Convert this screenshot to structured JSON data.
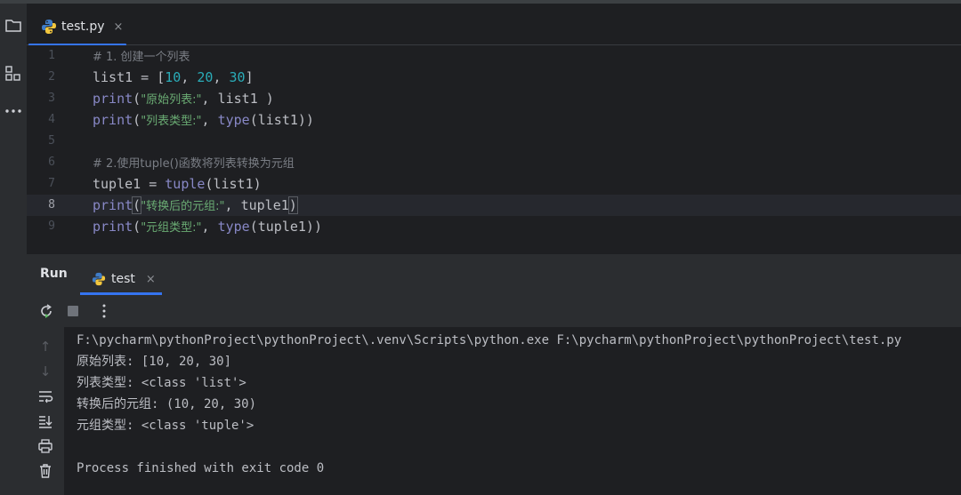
{
  "editor_tab": {
    "filename": "test.py",
    "close": "×"
  },
  "code_lines": [
    {
      "n": "1",
      "parts": [
        {
          "t": "# 1. 创建一个列表",
          "c": "cm"
        }
      ]
    },
    {
      "n": "2",
      "parts": [
        {
          "t": "list1 = ["
        },
        {
          "t": "10",
          "c": "num"
        },
        {
          "t": ", "
        },
        {
          "t": "20",
          "c": "num"
        },
        {
          "t": ", "
        },
        {
          "t": "30",
          "c": "num"
        },
        {
          "t": "]"
        }
      ]
    },
    {
      "n": "3",
      "parts": [
        {
          "t": "print",
          "c": "kw"
        },
        {
          "t": "("
        },
        {
          "t": "\"原始列表:\"",
          "c": "str"
        },
        {
          "t": ", list1 )"
        }
      ]
    },
    {
      "n": "4",
      "parts": [
        {
          "t": "print",
          "c": "kw"
        },
        {
          "t": "("
        },
        {
          "t": "\"列表类型:\"",
          "c": "str"
        },
        {
          "t": ", "
        },
        {
          "t": "type",
          "c": "kw"
        },
        {
          "t": "(list1))"
        }
      ]
    },
    {
      "n": "5",
      "parts": []
    },
    {
      "n": "6",
      "parts": [
        {
          "t": "# 2.使用tuple()函数将列表转换为元组",
          "c": "cm"
        }
      ]
    },
    {
      "n": "7",
      "parts": [
        {
          "t": "tuple1 = "
        },
        {
          "t": "tuple",
          "c": "kw"
        },
        {
          "t": "(list1)"
        }
      ]
    },
    {
      "n": "8",
      "current": true,
      "parts": [
        {
          "t": "print",
          "c": "kw"
        },
        {
          "t": "(",
          "c": "bm"
        },
        {
          "t": "\"转换后的元组:\"",
          "c": "str"
        },
        {
          "t": ", tuple1"
        },
        {
          "t": ")",
          "c": "bm"
        }
      ]
    },
    {
      "n": "9",
      "parts": [
        {
          "t": "print",
          "c": "kw"
        },
        {
          "t": "("
        },
        {
          "t": "\"元组类型:\"",
          "c": "str"
        },
        {
          "t": ", "
        },
        {
          "t": "type",
          "c": "kw"
        },
        {
          "t": "(tuple1))"
        }
      ]
    }
  ],
  "run_panel": {
    "title": "Run",
    "tab_label": "test",
    "tab_close": "×",
    "console_lines": [
      "F:\\pycharm\\pythonProject\\pythonProject\\.venv\\Scripts\\python.exe F:\\pycharm\\pythonProject\\pythonProject\\test.py",
      "原始列表: [10, 20, 30]",
      "列表类型: <class 'list'>",
      "转换后的元组: (10, 20, 30)",
      "元组类型: <class 'tuple'>",
      "",
      "Process finished with exit code 0"
    ]
  },
  "colors": {
    "accent": "#3574f0",
    "background": "#1e1f22",
    "panel": "#2b2d30",
    "string": "#6aab73",
    "keyword": "#8888c6",
    "number": "#2aacb8",
    "comment": "#7a7e85"
  },
  "icons": {
    "stripe": [
      "folder-icon",
      "structure-icon",
      "more-icon"
    ],
    "toolbar": [
      "rerun-icon",
      "stop-icon",
      "more-vertical-icon"
    ],
    "console_side": [
      "scroll-up-icon",
      "scroll-down-icon",
      "soft-wrap-icon",
      "scroll-to-end-icon",
      "print-icon",
      "trash-icon"
    ]
  }
}
